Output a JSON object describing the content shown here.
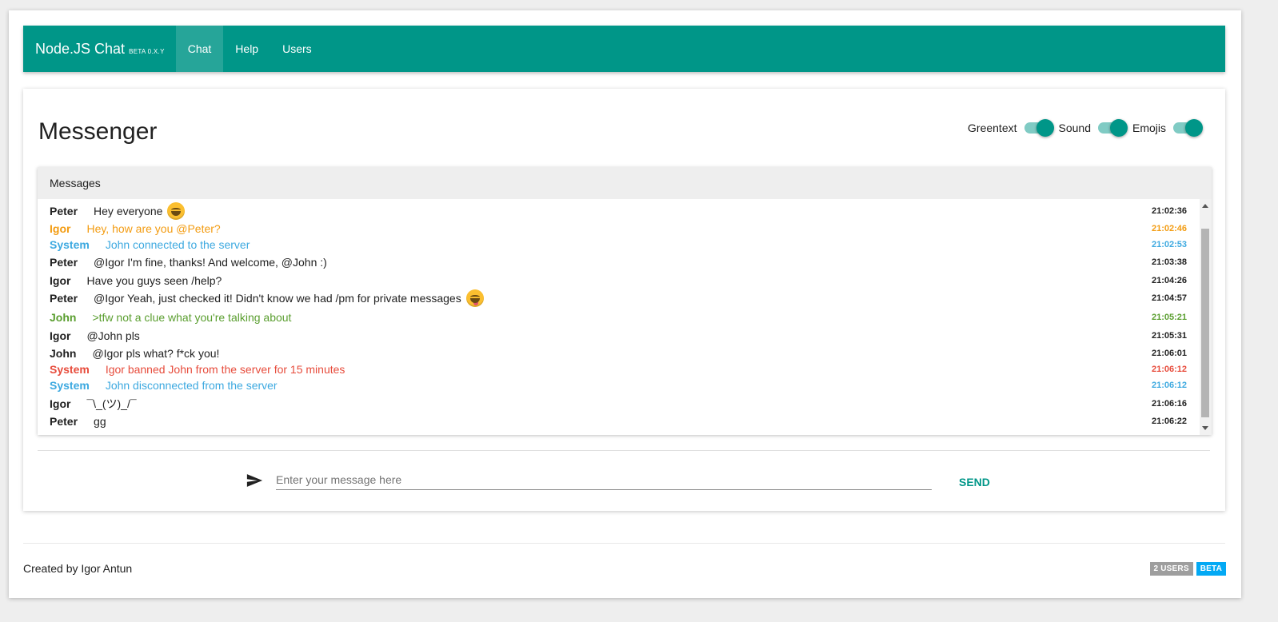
{
  "nav": {
    "brand": "Node.JS Chat",
    "version": "BETA 0.X.Y",
    "items": [
      {
        "label": "Chat",
        "active": true
      },
      {
        "label": "Help",
        "active": false
      },
      {
        "label": "Users",
        "active": false
      }
    ]
  },
  "messenger": {
    "title": "Messenger",
    "toggles": [
      {
        "label": "Greentext",
        "on": true
      },
      {
        "label": "Sound",
        "on": true
      },
      {
        "label": "Emojis",
        "on": true
      }
    ],
    "panel_title": "Messages",
    "messages": [
      {
        "user": "Peter",
        "text": "Hey everyone",
        "time": "21:02:36",
        "color": "default",
        "emoji": "grin"
      },
      {
        "user": "Igor",
        "text": "Hey, how are you @Peter?",
        "time": "21:02:46",
        "color": "orange",
        "emoji": ""
      },
      {
        "user": "System",
        "text": "John connected to the server",
        "time": "21:02:53",
        "color": "blue",
        "emoji": ""
      },
      {
        "user": "Peter",
        "text": "@Igor I'm fine, thanks! And welcome, @John :)",
        "time": "21:03:38",
        "color": "default",
        "emoji": ""
      },
      {
        "user": "Igor",
        "text": "Have you guys seen /help?",
        "time": "21:04:26",
        "color": "default",
        "emoji": ""
      },
      {
        "user": "Peter",
        "text": "@Igor Yeah, just checked it! Didn't know we had /pm for private messages",
        "time": "21:04:57",
        "color": "default",
        "emoji": "tongue"
      },
      {
        "user": "John",
        "text": ">tfw not a clue what you're talking about",
        "time": "21:05:21",
        "color": "green",
        "emoji": ""
      },
      {
        "user": "Igor",
        "text": "@John pls",
        "time": "21:05:31",
        "color": "default",
        "emoji": ""
      },
      {
        "user": "John",
        "text": "@Igor pls what? f*ck you!",
        "time": "21:06:01",
        "color": "default",
        "emoji": ""
      },
      {
        "user": "System",
        "text": "Igor banned John from the server for 15 minutes",
        "time": "21:06:12",
        "color": "red",
        "emoji": ""
      },
      {
        "user": "System",
        "text": "John disconnected from the server",
        "time": "21:06:12",
        "color": "blue",
        "emoji": ""
      },
      {
        "user": "Igor",
        "text": "¯\\_(ツ)_/¯",
        "time": "21:06:16",
        "color": "default",
        "emoji": ""
      },
      {
        "user": "Peter",
        "text": "gg",
        "time": "21:06:22",
        "color": "default",
        "emoji": ""
      }
    ],
    "input_placeholder": "Enter your message here",
    "input_value": "",
    "send_label": "SEND"
  },
  "footer": {
    "credit": "Created by Igor Antun",
    "users_badge": "2 USERS",
    "beta_badge": "BETA"
  },
  "colors": {
    "primary": "#009688",
    "orange": "#f39c12",
    "blue": "#3da9e0",
    "green": "#5a9e2f",
    "red": "#e74c3c"
  }
}
